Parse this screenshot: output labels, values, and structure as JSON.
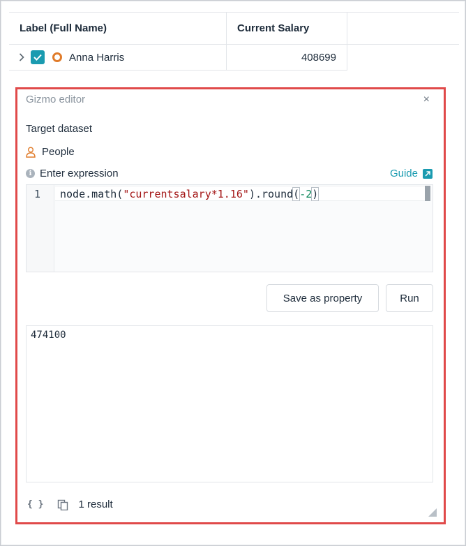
{
  "table": {
    "headers": {
      "name": "Label (Full Name)",
      "salary": "Current Salary"
    },
    "row": {
      "name": "Anna Harris",
      "salary": "408699",
      "checked": true
    }
  },
  "editor": {
    "title": "Gizmo editor",
    "close": "×",
    "target_dataset_label": "Target dataset",
    "dataset": "People",
    "expression_label": "Enter expression",
    "info_icon": "i",
    "guide_label": "Guide",
    "line_number": "1",
    "code": {
      "part1": "node.math(",
      "string": "\"currentsalary*1.16\"",
      "part2": ").round",
      "open_paren": "(",
      "number": "-2",
      "close_paren": ")"
    },
    "save_label": "Save as property",
    "run_label": "Run",
    "result_value": "474100",
    "braces": "{ }",
    "result_count": "1 result"
  },
  "colors": {
    "accent": "#1a9bb0",
    "node": "#e07b2a",
    "highlight_border": "#e04a4a"
  }
}
